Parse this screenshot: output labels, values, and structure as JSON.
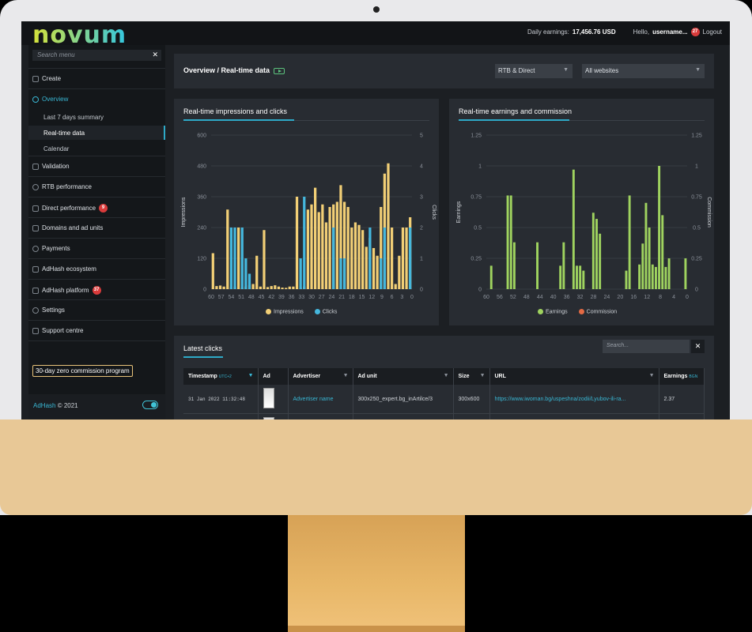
{
  "topbar": {
    "logo": "novum",
    "daily_label": "Daily earnings:",
    "daily_value": "17,456.76 USD",
    "hello": "Hello,",
    "username": "username...",
    "notif_count": "27",
    "logout": "Logout"
  },
  "sidebar": {
    "search_placeholder": "Search menu",
    "close": "✕",
    "create": "Create",
    "overview": "Overview",
    "sub_items": [
      "Last 7 days summary",
      "Real-time data",
      "Calendar"
    ],
    "items": [
      {
        "label": "Validation"
      },
      {
        "label": "RTB performance"
      },
      {
        "label": "Direct performance",
        "badge": "9"
      },
      {
        "label": "Domains and ad units"
      },
      {
        "label": "Payments"
      },
      {
        "label": "AdHash ecosystem"
      },
      {
        "label": "AdHash platform",
        "badge": "37"
      },
      {
        "label": "Settings"
      },
      {
        "label": "Support centre"
      }
    ],
    "program": "30-day zero commission program",
    "footer_brand": "AdHash",
    "footer_copy": "© 2021"
  },
  "header": {
    "title": "Overview / Real-time data",
    "filter1": "RTB & Direct",
    "filter2": "All websites"
  },
  "colors": {
    "impressions": "#f2cf76",
    "clicks": "#45b7dd",
    "earnings": "#9fd35f",
    "commission": "#e36a44",
    "accent": "#2ea9c7"
  },
  "chart_data": [
    {
      "type": "bar",
      "title": "Real-time impressions and clicks",
      "ylabel": "Impressions",
      "y2label": "Clicks",
      "ylim": [
        0,
        600
      ],
      "y2lim": [
        0,
        5
      ],
      "yticks": [
        "0",
        "120",
        "240",
        "360",
        "480",
        "600"
      ],
      "y2ticks": [
        "0",
        "1",
        "2",
        "3",
        "4",
        "5"
      ],
      "xticks": [
        "60",
        "57",
        "54",
        "51",
        "48",
        "45",
        "42",
        "39",
        "36",
        "33",
        "30",
        "27",
        "24",
        "21",
        "18",
        "15",
        "12",
        "9",
        "6",
        "3",
        "0"
      ],
      "x_start": 60,
      "series": [
        {
          "name": "Impressions",
          "values": [
            140,
            12,
            14,
            10,
            310,
            8,
            10,
            240,
            5,
            10,
            15,
            20,
            130,
            10,
            230,
            8,
            12,
            15,
            10,
            6,
            5,
            10,
            10,
            360,
            5,
            10,
            310,
            330,
            395,
            300,
            330,
            260,
            320,
            330,
            340,
            405,
            340,
            320,
            240,
            260,
            250,
            230,
            165,
            200,
            160,
            130,
            320,
            450,
            490,
            240,
            20,
            130,
            240,
            240,
            280
          ]
        },
        {
          "name": "Clicks",
          "values": [
            0,
            0,
            0,
            0,
            0,
            2,
            2,
            0,
            2,
            1,
            0.5,
            0,
            0,
            0,
            0,
            0,
            0,
            0,
            0,
            0,
            0,
            0,
            0,
            0,
            1,
            3,
            0,
            0,
            0,
            0,
            0,
            0,
            0,
            2,
            0,
            1,
            1,
            0,
            0,
            0,
            0,
            0,
            0,
            2,
            0,
            0,
            1,
            2,
            0,
            0,
            0,
            0,
            0,
            0,
            2
          ]
        }
      ]
    },
    {
      "type": "bar",
      "title": "Real-time earnings and commission",
      "ylabel": "Earnings",
      "y2label": "Commission",
      "ylim": [
        0,
        1.25
      ],
      "y2lim": [
        0,
        1.25
      ],
      "yticks": [
        "0",
        "0.25",
        "0.5",
        "0.75",
        "1",
        "1.25"
      ],
      "y2ticks": [
        "0",
        "0.25",
        "0.5",
        "0.75",
        "1",
        "1.25"
      ],
      "xticks": [
        "60",
        "56",
        "52",
        "48",
        "44",
        "40",
        "36",
        "32",
        "28",
        "24",
        "20",
        "16",
        "12",
        "8",
        "4",
        "0"
      ],
      "x_start": 60,
      "series": [
        {
          "name": "Earnings",
          "values": [
            0,
            0.19,
            0,
            0,
            0,
            0,
            0.76,
            0.76,
            0.38,
            0,
            0,
            0,
            0,
            0,
            0,
            0.38,
            0,
            0,
            0,
            0,
            0,
            0,
            0.19,
            0.38,
            0,
            0,
            0.97,
            0.19,
            0.19,
            0.15,
            0,
            0,
            0.62,
            0.57,
            0.45,
            0,
            0,
            0,
            0,
            0,
            0,
            0,
            0.15,
            0.76,
            0,
            0,
            0.2,
            0.37,
            0.7,
            0.5,
            0.2,
            0.18,
            1.0,
            0.6,
            0.18,
            0.25,
            0,
            0,
            0,
            0,
            0.25
          ]
        },
        {
          "name": "Commission",
          "values": [
            0,
            0,
            0,
            0,
            0,
            0,
            0,
            0,
            0,
            0,
            0,
            0,
            0,
            0,
            0,
            0,
            0,
            0,
            0,
            0,
            0,
            0,
            0,
            0,
            0,
            0,
            0,
            0,
            0,
            0,
            0,
            0,
            0,
            0,
            0,
            0,
            0,
            0,
            0,
            0,
            0,
            0,
            0,
            0,
            0,
            0,
            0,
            0,
            0,
            0,
            0,
            0,
            0,
            0,
            0,
            0,
            0,
            0,
            0,
            0,
            0
          ]
        }
      ]
    }
  ],
  "latest_clicks": {
    "title": "Latest clicks",
    "search_placeholder": "Search...",
    "close": "✕",
    "columns": [
      {
        "label": "Timestamp",
        "sub": "UTC+2"
      },
      {
        "label": "Ad"
      },
      {
        "label": "Advertiser"
      },
      {
        "label": "Ad unit"
      },
      {
        "label": "Size"
      },
      {
        "label": "URL"
      },
      {
        "label": "Earnings",
        "sub": "BGN"
      }
    ],
    "rows": [
      {
        "timestamp": "31 Jan 2022 11:32:48",
        "advertiser": "Advertiser name",
        "ad_unit": "300x250_expert.bg_inArtilce/3",
        "size": "300x600",
        "url": "https://www.iwoman.bg/uspeshna/zodii/Lyubov-ili-ra...",
        "earnings": "2.37"
      }
    ]
  }
}
